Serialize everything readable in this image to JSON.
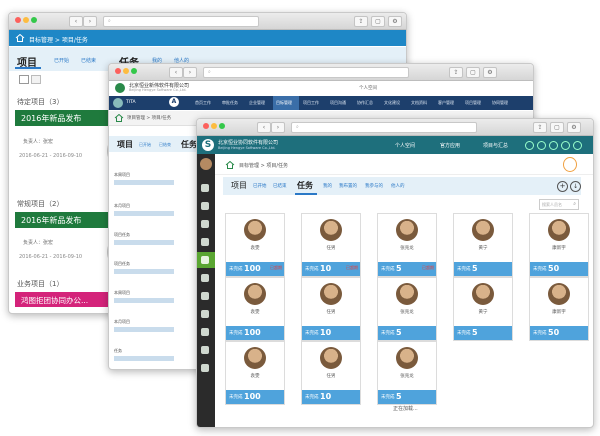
{
  "win1": {
    "breadcrumb": "目标管理 > 项目/任务",
    "tabs": {
      "project": "项目",
      "task": "任务",
      "started": "已开始",
      "ended": "已结束",
      "mine": "我的",
      "others": "他人的"
    },
    "section_label": "待定项目（3）",
    "card1_title": "2016年新品发布",
    "owner_label": "负责人：张宏",
    "dates": "2016-06-21 - 2016-09-10",
    "section2_label": "常规项目（2）",
    "card2_title": "2016年新品发布",
    "owner2_label": "负责人：张宏",
    "dates2": "2016-06-21 - 2016-09-10",
    "section3_label": "业务项目（1）",
    "card3_title": "鸿图拒团协同办公..."
  },
  "win2": {
    "company": "北京恒业新伟软件有限公司",
    "company_en": "Beijing Hengye Software Co.,Ltd.",
    "user": "TITA",
    "nav": [
      "首页工作",
      "审批任务",
      "企业管理",
      "目标管理",
      "项目工作",
      "项目沟通",
      "协作汇总",
      "文化建设",
      "文档资料",
      "客户管理",
      "项目管理",
      "协同管理"
    ],
    "breadcrumb": "项目管理 > 项目/任务",
    "tabs": {
      "project": "项目",
      "started": "已开始",
      "ended": "已结束",
      "task": "任务"
    },
    "list": [
      "本周项目",
      "本月项目",
      "项目任务",
      "项目任务",
      "本周项目",
      "本月项目",
      "任务"
    ],
    "right_user": "个人空间"
  },
  "win3": {
    "company": "北京恒业协同软件有限公司",
    "company_en": "Beijing Hengye Software Co.,Ltd.",
    "header_links": [
      "个人空间",
      "官方应用",
      "项目与汇总"
    ],
    "breadcrumb": "目标管理 > 项目/任务",
    "tabs": {
      "project": "项目",
      "started": "已开始",
      "ended": "已结束",
      "task": "任务",
      "mine": "我的",
      "assign": "我布置的",
      "participate": "我参与的",
      "others": "他人的"
    },
    "search_placeholder": "搜索人员名",
    "loading": "正在加载...",
    "cards": [
      {
        "name": "袁雯",
        "label": "未完成",
        "count": "100",
        "extra": "已超期"
      },
      {
        "name": "任男",
        "label": "未完成",
        "count": "10",
        "extra": "已超期"
      },
      {
        "name": "张兆龙",
        "label": "未完成",
        "count": "5",
        "extra": "已超期"
      },
      {
        "name": "黄宁",
        "label": "未完成",
        "count": "5",
        "extra": ""
      },
      {
        "name": "康新宇",
        "label": "未完成",
        "count": "50",
        "extra": ""
      },
      {
        "name": "袁雯",
        "label": "未完成",
        "count": "100",
        "extra": ""
      },
      {
        "name": "任男",
        "label": "未完成",
        "count": "10",
        "extra": ""
      },
      {
        "name": "张兆龙",
        "label": "未完成",
        "count": "5",
        "extra": ""
      },
      {
        "name": "黄宁",
        "label": "未完成",
        "count": "5",
        "extra": ""
      },
      {
        "name": "康新宇",
        "label": "未完成",
        "count": "50",
        "extra": ""
      },
      {
        "name": "袁雯",
        "label": "未完成",
        "count": "100",
        "extra": ""
      },
      {
        "name": "任男",
        "label": "未完成",
        "count": "10",
        "extra": ""
      },
      {
        "name": "张兆龙",
        "label": "未完成",
        "count": "5",
        "extra": ""
      }
    ]
  }
}
